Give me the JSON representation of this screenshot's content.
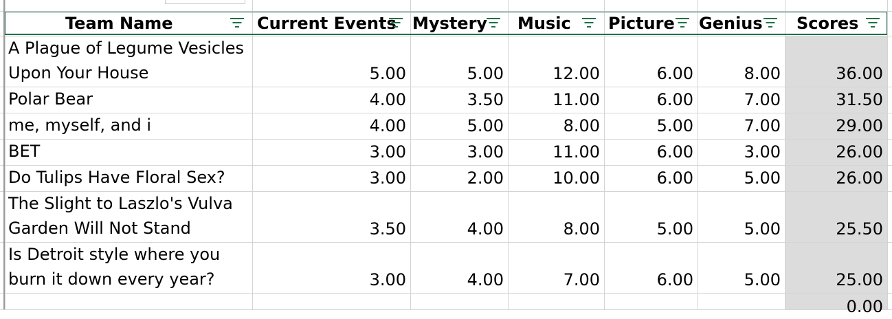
{
  "columns": [
    {
      "key": "team",
      "label": "Team Name"
    },
    {
      "key": "current_events",
      "label": "Current Events"
    },
    {
      "key": "mystery",
      "label": "Mystery"
    },
    {
      "key": "music",
      "label": "Music"
    },
    {
      "key": "picture",
      "label": "Picture"
    },
    {
      "key": "genius",
      "label": "Genius"
    },
    {
      "key": "scores",
      "label": "Scores"
    }
  ],
  "rows": [
    {
      "team": [
        "A Plague of Legume Vesicles",
        "Upon Your House"
      ],
      "values": [
        "5.00",
        "5.00",
        "12.00",
        "6.00",
        "8.00",
        "36.00"
      ]
    },
    {
      "team": [
        "Polar Bear"
      ],
      "values": [
        "4.00",
        "3.50",
        "11.00",
        "6.00",
        "7.00",
        "31.50"
      ]
    },
    {
      "team": [
        "me, myself, and i"
      ],
      "values": [
        "4.00",
        "5.00",
        "8.00",
        "5.00",
        "7.00",
        "29.00"
      ]
    },
    {
      "team": [
        "BET"
      ],
      "values": [
        "3.00",
        "3.00",
        "11.00",
        "6.00",
        "3.00",
        "26.00"
      ]
    },
    {
      "team": [
        "Do Tulips Have Floral Sex?"
      ],
      "values": [
        "3.00",
        "2.00",
        "10.00",
        "6.00",
        "5.00",
        "26.00"
      ]
    },
    {
      "team": [
        "The Slight to Laszlo's Vulva",
        "Garden Will Not Stand"
      ],
      "values": [
        "3.50",
        "4.00",
        "8.00",
        "5.00",
        "5.00",
        "25.50"
      ]
    },
    {
      "team": [
        "Is Detroit style where you",
        "burn it down every year?"
      ],
      "values": [
        "3.00",
        "4.00",
        "7.00",
        "6.00",
        "5.00",
        "25.00"
      ]
    },
    {
      "team": [
        ""
      ],
      "values": [
        "",
        "",
        "",
        "",
        "",
        "0.00"
      ]
    }
  ],
  "icons": {
    "filter": "filter-icon"
  },
  "colors": {
    "header_border": "#1e7145",
    "gridline": "#d4d4d4",
    "scores_fill": "#dcdcdc"
  }
}
